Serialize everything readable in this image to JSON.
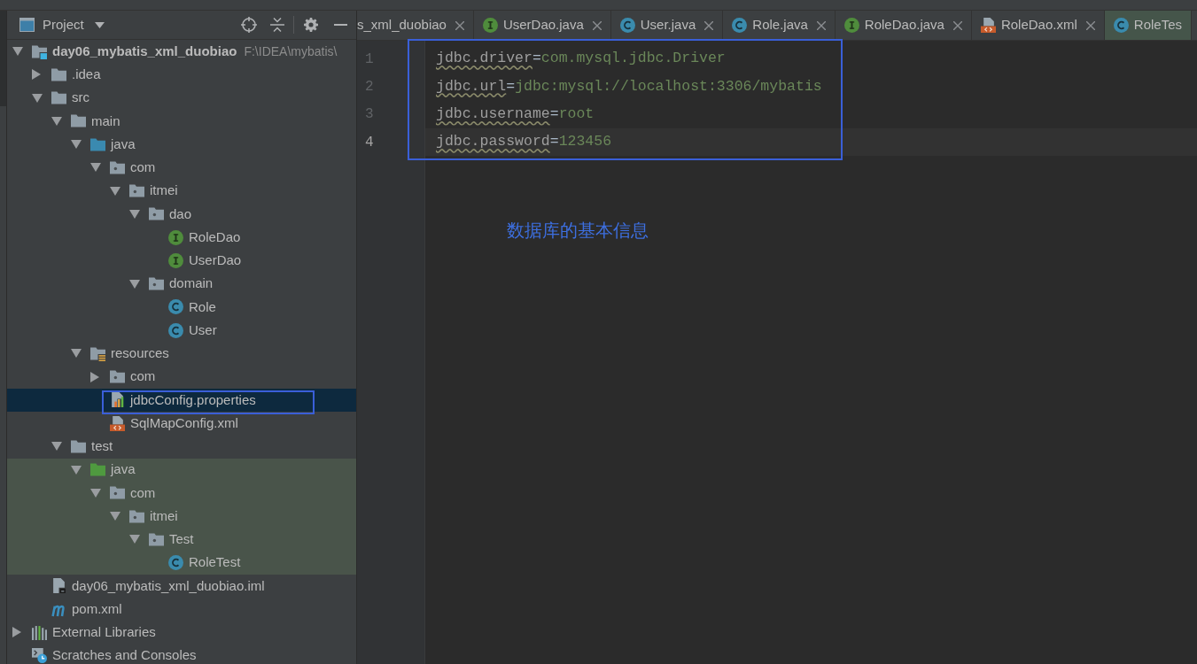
{
  "project_panel": {
    "title": "Project",
    "tree": [
      {
        "label": "day06_mybatis_xml_duobiao",
        "path": "F:\\IDEA\\mybatis\\",
        "kind": "module",
        "expanded": true,
        "selected": false,
        "test_scope": false,
        "children": [
          {
            "label": ".idea",
            "kind": "folder",
            "expanded": false,
            "selected": false,
            "test_scope": false
          },
          {
            "label": "src",
            "kind": "folder",
            "expanded": true,
            "selected": false,
            "test_scope": false,
            "children": [
              {
                "label": "main",
                "kind": "folder",
                "expanded": true,
                "selected": false,
                "test_scope": false,
                "children": [
                  {
                    "label": "java",
                    "kind": "sources",
                    "expanded": true,
                    "selected": false,
                    "test_scope": false,
                    "children": [
                      {
                        "label": "com",
                        "kind": "package",
                        "expanded": true,
                        "selected": false,
                        "test_scope": false,
                        "children": [
                          {
                            "label": "itmei",
                            "kind": "package",
                            "expanded": true,
                            "selected": false,
                            "test_scope": false,
                            "children": [
                              {
                                "label": "dao",
                                "kind": "package",
                                "expanded": true,
                                "selected": false,
                                "test_scope": false,
                                "children": [
                                  {
                                    "label": "RoleDao",
                                    "kind": "interface",
                                    "selected": false,
                                    "test_scope": false
                                  },
                                  {
                                    "label": "UserDao",
                                    "kind": "interface",
                                    "selected": false,
                                    "test_scope": false
                                  }
                                ]
                              },
                              {
                                "label": "domain",
                                "kind": "package",
                                "expanded": true,
                                "selected": false,
                                "test_scope": false,
                                "children": [
                                  {
                                    "label": "Role",
                                    "kind": "class",
                                    "selected": false,
                                    "test_scope": false
                                  },
                                  {
                                    "label": "User",
                                    "kind": "class",
                                    "selected": false,
                                    "test_scope": false
                                  }
                                ]
                              }
                            ]
                          }
                        ]
                      }
                    ]
                  },
                  {
                    "label": "resources",
                    "kind": "resources",
                    "expanded": true,
                    "selected": false,
                    "test_scope": false,
                    "children": [
                      {
                        "label": "com",
                        "kind": "package",
                        "expanded": false,
                        "selected": false,
                        "test_scope": false
                      },
                      {
                        "label": "jdbcConfig.properties",
                        "kind": "properties",
                        "selected": true,
                        "test_scope": false
                      },
                      {
                        "label": "SqlMapConfig.xml",
                        "kind": "xml",
                        "selected": false,
                        "test_scope": false
                      }
                    ]
                  }
                ]
              },
              {
                "label": "test",
                "kind": "folder",
                "expanded": true,
                "selected": false,
                "test_scope": false,
                "children": [
                  {
                    "label": "java",
                    "kind": "tests",
                    "expanded": true,
                    "selected": false,
                    "test_scope": true,
                    "children": [
                      {
                        "label": "com",
                        "kind": "package",
                        "expanded": true,
                        "selected": false,
                        "test_scope": true,
                        "children": [
                          {
                            "label": "itmei",
                            "kind": "package",
                            "expanded": true,
                            "selected": false,
                            "test_scope": true,
                            "children": [
                              {
                                "label": "Test",
                                "kind": "package",
                                "expanded": true,
                                "selected": false,
                                "test_scope": true,
                                "children": [
                                  {
                                    "label": "RoleTest",
                                    "kind": "class",
                                    "selected": false,
                                    "test_scope": true
                                  }
                                ]
                              }
                            ]
                          }
                        ]
                      }
                    ]
                  }
                ]
              }
            ]
          },
          {
            "label": "day06_mybatis_xml_duobiao.iml",
            "kind": "iml",
            "selected": false,
            "test_scope": false
          },
          {
            "label": "pom.xml",
            "kind": "maven",
            "selected": false,
            "test_scope": false
          }
        ]
      },
      {
        "label": "External Libraries",
        "kind": "libraries",
        "expanded": false,
        "selected": false,
        "test_scope": false
      },
      {
        "label": "Scratches and Consoles",
        "kind": "scratches",
        "selected": false,
        "test_scope": false
      }
    ]
  },
  "editor_tabs": [
    {
      "label": "s_xml_duobiao",
      "selected": false,
      "test_scope": false,
      "close_button": true
    },
    {
      "label": "UserDao.java",
      "kind": "interface",
      "selected": false,
      "test_scope": false,
      "close_button": true
    },
    {
      "label": "User.java",
      "kind": "class",
      "selected": false,
      "test_scope": false,
      "close_button": true
    },
    {
      "label": "Role.java",
      "kind": "class",
      "selected": false,
      "test_scope": false,
      "close_button": true
    },
    {
      "label": "RoleDao.java",
      "kind": "interface",
      "selected": false,
      "test_scope": false,
      "close_button": true
    },
    {
      "label": "RoleDao.xml",
      "kind": "xml",
      "selected": false,
      "test_scope": false,
      "close_button": true
    },
    {
      "label": "RoleTes",
      "kind": "class",
      "selected": false,
      "test_scope": true,
      "close_button": false
    }
  ],
  "editor": {
    "lines": [
      {
        "number": "1",
        "key": "jdbc.driver",
        "separator": "=",
        "value": "com.mysql.jdbc.Driver",
        "current": false
      },
      {
        "number": "2",
        "key": "jdbc.url",
        "separator": "=",
        "value": "jdbc:mysql://localhost:3306/mybatis",
        "current": false
      },
      {
        "number": "3",
        "key": "jdbc.username",
        "separator": "=",
        "value": "root",
        "current": false
      },
      {
        "number": "4",
        "key": "jdbc.password",
        "separator": "=",
        "value": "123456",
        "current": true
      }
    ]
  },
  "annotation": {
    "text": "数据库的基本信息"
  }
}
